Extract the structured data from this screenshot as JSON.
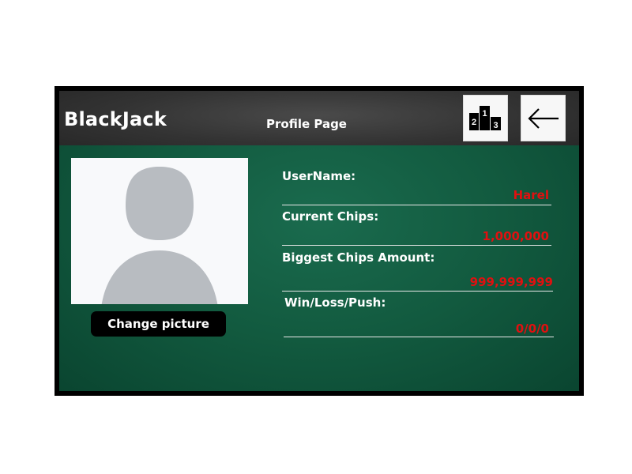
{
  "header": {
    "app_title": "BlackJack",
    "page_title": "Profile Page",
    "leaderboard_icon": "podium-icon",
    "back_icon": "arrow-left-icon",
    "podium_ranks": [
      "2",
      "1",
      "3"
    ]
  },
  "avatar": {
    "icon": "user-placeholder-icon",
    "change_picture_label": "Change picture"
  },
  "profile": {
    "fields": [
      {
        "label": "UserName:",
        "value": "Harel"
      },
      {
        "label": "Current Chips:",
        "value": "1,000,000"
      },
      {
        "label": "Biggest Chips Amount:",
        "value": "999,999,999"
      },
      {
        "label": "Win/Loss/Push:",
        "value": "0/0/0"
      }
    ]
  },
  "colors": {
    "header_bg": "#333333",
    "content_bg": "#125a3f",
    "value_color": "#e01010",
    "frame": "#000000"
  }
}
